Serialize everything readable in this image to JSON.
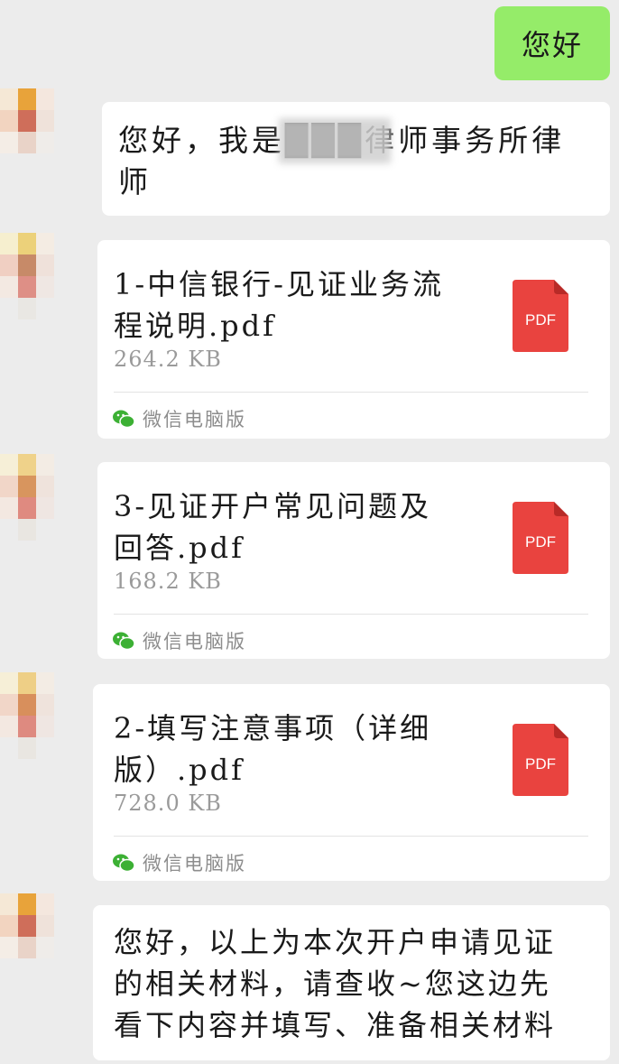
{
  "outgoing": {
    "text": "您好"
  },
  "messages": [
    {
      "type": "text",
      "text": "您好，我是███律师事务所律\n师"
    },
    {
      "type": "file",
      "name": "1-中信银行-见证业务流\n程说明.pdf",
      "size": "264.2 KB",
      "icon_label": "PDF",
      "source": "微信电脑版"
    },
    {
      "type": "file",
      "name": "3-见证开户常见问题及\n回答.pdf",
      "size": "168.2 KB",
      "icon_label": "PDF",
      "source": "微信电脑版"
    },
    {
      "type": "file",
      "name": "2-填写注意事项（详细\n版）.pdf",
      "size": "728.0 KB",
      "icon_label": "PDF",
      "source": "微信电脑版"
    },
    {
      "type": "text",
      "text": "您好，以上为本次开户申请见证\n的相关材料，请查收~您这边先\n看下内容并填写、准备相关材料"
    }
  ],
  "colors": {
    "background": "#ececec",
    "outgoing_bubble": "#95ec69",
    "incoming_bubble": "#ffffff",
    "pdf_red": "#e9433f",
    "wechat_green": "#3cb034"
  }
}
